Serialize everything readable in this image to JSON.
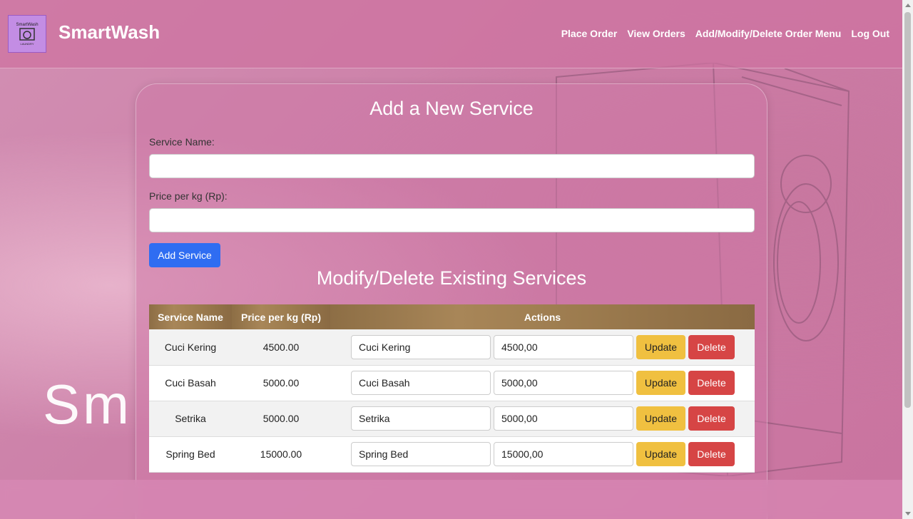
{
  "header": {
    "logo_line1": "SmartWash",
    "logo_line2": "LAUNDRY",
    "brand": "SmartWash",
    "nav": [
      "Place Order",
      "View Orders",
      "Add/Modify/Delete Order Menu",
      "Log Out"
    ]
  },
  "background": {
    "big_text": "Sm"
  },
  "add_form": {
    "title": "Add a New Service",
    "service_name_label": "Service Name:",
    "service_name_value": "",
    "price_label": "Price per kg (Rp):",
    "price_value": "",
    "submit_label": "Add Service"
  },
  "modify": {
    "title": "Modify/Delete Existing Services",
    "columns": [
      "Service Name",
      "Price per kg (Rp)",
      "Actions"
    ],
    "update_label": "Update",
    "delete_label": "Delete",
    "rows": [
      {
        "name": "Cuci Kering",
        "price": "4500.00",
        "edit_name": "Cuci Kering",
        "edit_price": "4500,00"
      },
      {
        "name": "Cuci Basah",
        "price": "5000.00",
        "edit_name": "Cuci Basah",
        "edit_price": "5000,00"
      },
      {
        "name": "Setrika",
        "price": "5000.00",
        "edit_name": "Setrika",
        "edit_price": "5000,00"
      },
      {
        "name": "Spring Bed",
        "price": "15000.00",
        "edit_name": "Spring Bed",
        "edit_price": "15000,00"
      }
    ]
  },
  "colors": {
    "accent_blue": "#2f6df2",
    "update_yellow": "#f0c040",
    "delete_red": "#d64545",
    "background_pink": "#cc80a8"
  }
}
